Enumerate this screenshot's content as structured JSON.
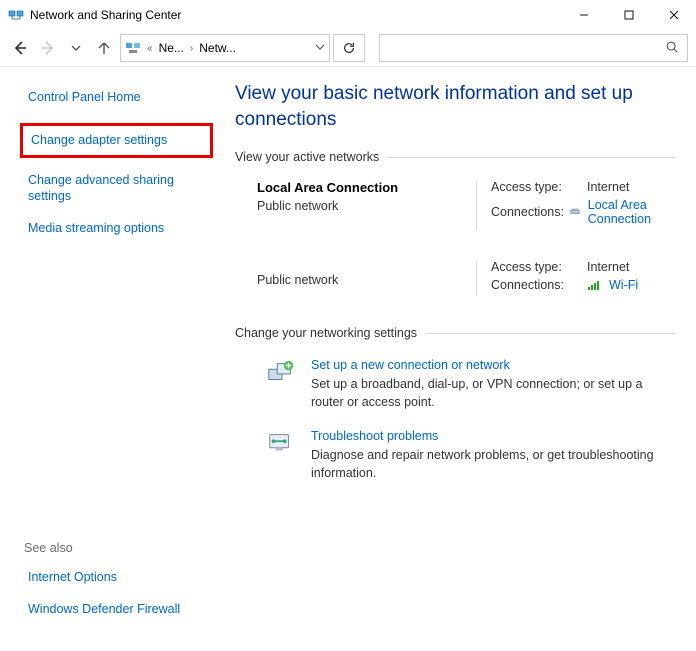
{
  "window": {
    "title": "Network and Sharing Center"
  },
  "breadcrumb": {
    "parent_short": "Ne...",
    "current_short": "Netw..."
  },
  "search": {
    "placeholder": ""
  },
  "sidebar": {
    "home": "Control Panel Home",
    "links": [
      "Change adapter settings",
      "Change advanced sharing settings",
      "Media streaming options"
    ],
    "seealso_label": "See also",
    "seealso": [
      "Internet Options",
      "Windows Defender Firewall"
    ]
  },
  "main": {
    "title": "View your basic network information and set up connections",
    "active_section": "View your active networks",
    "networks": [
      {
        "name": "Local Area Connection",
        "type": "Public network",
        "access_label": "Access type:",
        "access_value": "Internet",
        "conn_label": "Connections:",
        "conn_value": "Local Area Connection",
        "adapter_icon": "ethernet"
      },
      {
        "name": "",
        "type": "Public network",
        "access_label": "Access type:",
        "access_value": "Internet",
        "conn_label": "Connections:",
        "conn_value": "Wi-Fi",
        "adapter_icon": "wifi"
      }
    ],
    "change_section": "Change your networking settings",
    "settings": [
      {
        "icon": "new-connection",
        "title": "Set up a new connection or network",
        "desc": "Set up a broadband, dial-up, or VPN connection; or set up a router or access point."
      },
      {
        "icon": "troubleshoot",
        "title": "Troubleshoot problems",
        "desc": "Diagnose and repair network problems, or get troubleshooting information."
      }
    ]
  }
}
